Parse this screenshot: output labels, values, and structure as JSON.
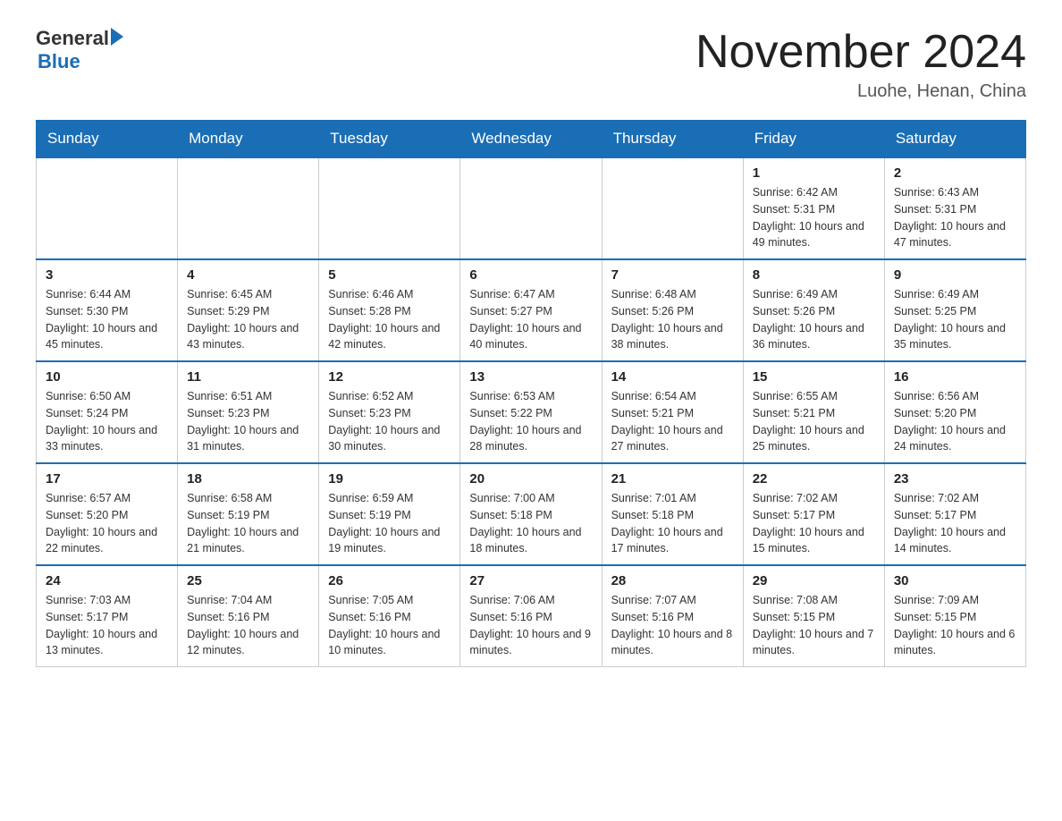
{
  "header": {
    "logo_general": "General",
    "logo_blue": "Blue",
    "month_title": "November 2024",
    "location": "Luohe, Henan, China"
  },
  "days_of_week": [
    "Sunday",
    "Monday",
    "Tuesday",
    "Wednesday",
    "Thursday",
    "Friday",
    "Saturday"
  ],
  "weeks": [
    [
      {
        "day": "",
        "info": ""
      },
      {
        "day": "",
        "info": ""
      },
      {
        "day": "",
        "info": ""
      },
      {
        "day": "",
        "info": ""
      },
      {
        "day": "",
        "info": ""
      },
      {
        "day": "1",
        "info": "Sunrise: 6:42 AM\nSunset: 5:31 PM\nDaylight: 10 hours and 49 minutes."
      },
      {
        "day": "2",
        "info": "Sunrise: 6:43 AM\nSunset: 5:31 PM\nDaylight: 10 hours and 47 minutes."
      }
    ],
    [
      {
        "day": "3",
        "info": "Sunrise: 6:44 AM\nSunset: 5:30 PM\nDaylight: 10 hours and 45 minutes."
      },
      {
        "day": "4",
        "info": "Sunrise: 6:45 AM\nSunset: 5:29 PM\nDaylight: 10 hours and 43 minutes."
      },
      {
        "day": "5",
        "info": "Sunrise: 6:46 AM\nSunset: 5:28 PM\nDaylight: 10 hours and 42 minutes."
      },
      {
        "day": "6",
        "info": "Sunrise: 6:47 AM\nSunset: 5:27 PM\nDaylight: 10 hours and 40 minutes."
      },
      {
        "day": "7",
        "info": "Sunrise: 6:48 AM\nSunset: 5:26 PM\nDaylight: 10 hours and 38 minutes."
      },
      {
        "day": "8",
        "info": "Sunrise: 6:49 AM\nSunset: 5:26 PM\nDaylight: 10 hours and 36 minutes."
      },
      {
        "day": "9",
        "info": "Sunrise: 6:49 AM\nSunset: 5:25 PM\nDaylight: 10 hours and 35 minutes."
      }
    ],
    [
      {
        "day": "10",
        "info": "Sunrise: 6:50 AM\nSunset: 5:24 PM\nDaylight: 10 hours and 33 minutes."
      },
      {
        "day": "11",
        "info": "Sunrise: 6:51 AM\nSunset: 5:23 PM\nDaylight: 10 hours and 31 minutes."
      },
      {
        "day": "12",
        "info": "Sunrise: 6:52 AM\nSunset: 5:23 PM\nDaylight: 10 hours and 30 minutes."
      },
      {
        "day": "13",
        "info": "Sunrise: 6:53 AM\nSunset: 5:22 PM\nDaylight: 10 hours and 28 minutes."
      },
      {
        "day": "14",
        "info": "Sunrise: 6:54 AM\nSunset: 5:21 PM\nDaylight: 10 hours and 27 minutes."
      },
      {
        "day": "15",
        "info": "Sunrise: 6:55 AM\nSunset: 5:21 PM\nDaylight: 10 hours and 25 minutes."
      },
      {
        "day": "16",
        "info": "Sunrise: 6:56 AM\nSunset: 5:20 PM\nDaylight: 10 hours and 24 minutes."
      }
    ],
    [
      {
        "day": "17",
        "info": "Sunrise: 6:57 AM\nSunset: 5:20 PM\nDaylight: 10 hours and 22 minutes."
      },
      {
        "day": "18",
        "info": "Sunrise: 6:58 AM\nSunset: 5:19 PM\nDaylight: 10 hours and 21 minutes."
      },
      {
        "day": "19",
        "info": "Sunrise: 6:59 AM\nSunset: 5:19 PM\nDaylight: 10 hours and 19 minutes."
      },
      {
        "day": "20",
        "info": "Sunrise: 7:00 AM\nSunset: 5:18 PM\nDaylight: 10 hours and 18 minutes."
      },
      {
        "day": "21",
        "info": "Sunrise: 7:01 AM\nSunset: 5:18 PM\nDaylight: 10 hours and 17 minutes."
      },
      {
        "day": "22",
        "info": "Sunrise: 7:02 AM\nSunset: 5:17 PM\nDaylight: 10 hours and 15 minutes."
      },
      {
        "day": "23",
        "info": "Sunrise: 7:02 AM\nSunset: 5:17 PM\nDaylight: 10 hours and 14 minutes."
      }
    ],
    [
      {
        "day": "24",
        "info": "Sunrise: 7:03 AM\nSunset: 5:17 PM\nDaylight: 10 hours and 13 minutes."
      },
      {
        "day": "25",
        "info": "Sunrise: 7:04 AM\nSunset: 5:16 PM\nDaylight: 10 hours and 12 minutes."
      },
      {
        "day": "26",
        "info": "Sunrise: 7:05 AM\nSunset: 5:16 PM\nDaylight: 10 hours and 10 minutes."
      },
      {
        "day": "27",
        "info": "Sunrise: 7:06 AM\nSunset: 5:16 PM\nDaylight: 10 hours and 9 minutes."
      },
      {
        "day": "28",
        "info": "Sunrise: 7:07 AM\nSunset: 5:16 PM\nDaylight: 10 hours and 8 minutes."
      },
      {
        "day": "29",
        "info": "Sunrise: 7:08 AM\nSunset: 5:15 PM\nDaylight: 10 hours and 7 minutes."
      },
      {
        "day": "30",
        "info": "Sunrise: 7:09 AM\nSunset: 5:15 PM\nDaylight: 10 hours and 6 minutes."
      }
    ]
  ]
}
